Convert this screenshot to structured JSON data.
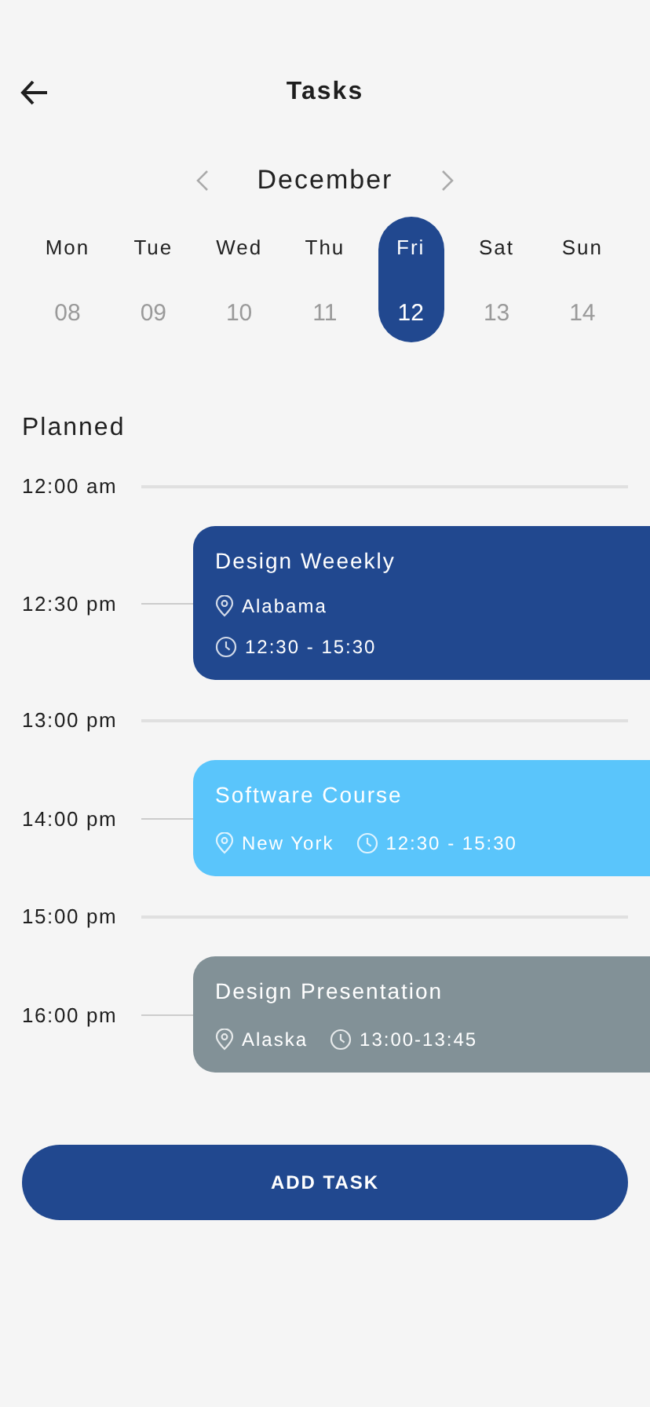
{
  "header": {
    "title": "Tasks"
  },
  "calendar": {
    "month": "December",
    "days": [
      {
        "weekday": "Mon",
        "date": "08",
        "selected": false
      },
      {
        "weekday": "Tue",
        "date": "09",
        "selected": false
      },
      {
        "weekday": "Wed",
        "date": "10",
        "selected": false
      },
      {
        "weekday": "Thu",
        "date": "11",
        "selected": false
      },
      {
        "weekday": "Fri",
        "date": "12",
        "selected": true
      },
      {
        "weekday": "Sat",
        "date": "13",
        "selected": false
      },
      {
        "weekday": "Sun",
        "date": "14",
        "selected": false
      }
    ]
  },
  "section_title": "Planned",
  "timeline": [
    {
      "kind": "slot",
      "time": "12:00 am"
    },
    {
      "kind": "task_stacked",
      "time": "12:30 pm",
      "title": "Design Weeekly",
      "location": "Alabama",
      "hours": "12:30 - 15:30",
      "color": "#21488f"
    },
    {
      "kind": "slot",
      "time": "13:00 pm"
    },
    {
      "kind": "task_inline",
      "time": "14:00 pm",
      "title": "Software Course",
      "location": "New York",
      "hours": "12:30 - 15:30",
      "color": "#5ac5fb"
    },
    {
      "kind": "slot",
      "time": "15:00 pm"
    },
    {
      "kind": "task_inline",
      "time": "16:00 pm",
      "title": "Design Presentation",
      "location": "Alaska",
      "hours": "13:00-13:45",
      "color": "#829197"
    }
  ],
  "add_button": "ADD TASK"
}
